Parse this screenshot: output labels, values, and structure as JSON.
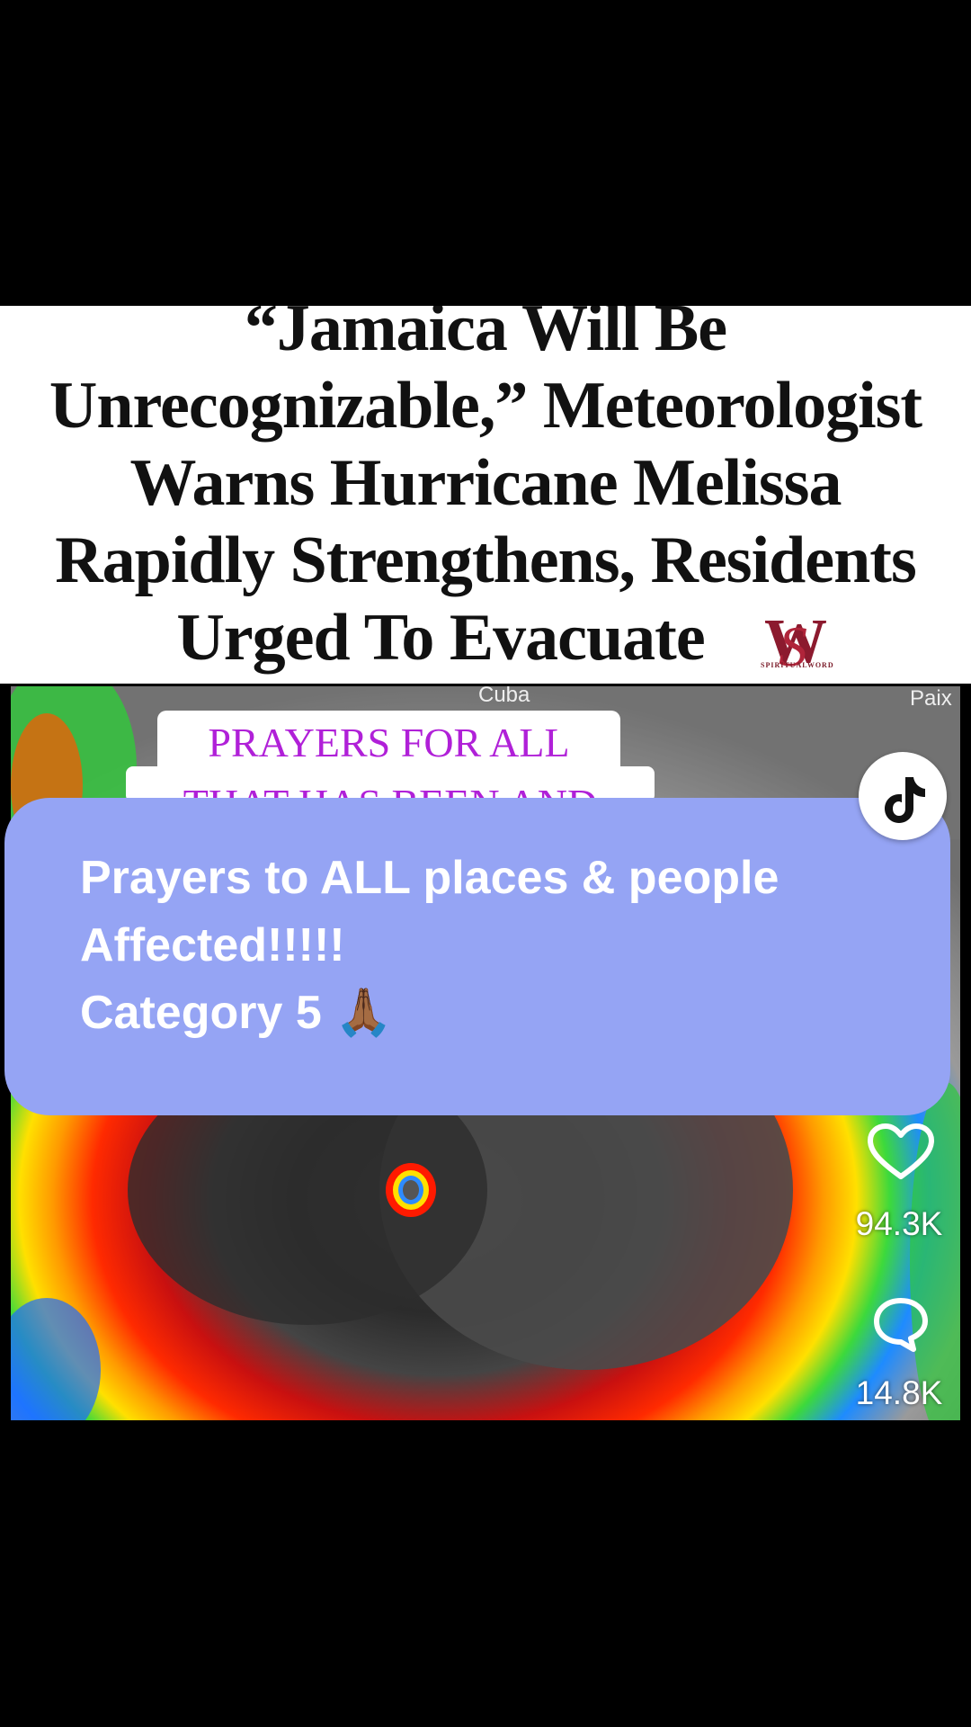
{
  "headline": {
    "lines": [
      "“Jamaica Will Be",
      "Unrecognizable,” Meteorologist",
      "Warns Hurricane Melissa",
      "Rapidly Strengthens, Residents",
      "Urged To Evacuate"
    ],
    "logo_text": "SPIRITUALWORD"
  },
  "map": {
    "label_top": "Cuba",
    "label_right": "Paix"
  },
  "overlay_box": {
    "line1": "PRAYERS FOR ALL",
    "line2": "THAT HAS BEEN AND"
  },
  "caption": {
    "line1": "Prayers to ALL places & people",
    "line2": "Affected!!!!!",
    "line3": "Category 5 🙏🏾"
  },
  "actions": {
    "likes": "94.3K",
    "comments": "14.8K"
  },
  "icons": {
    "tiktok": "tiktok-logo-icon",
    "like": "heart-icon",
    "comment": "comment-bubble-icon"
  }
}
